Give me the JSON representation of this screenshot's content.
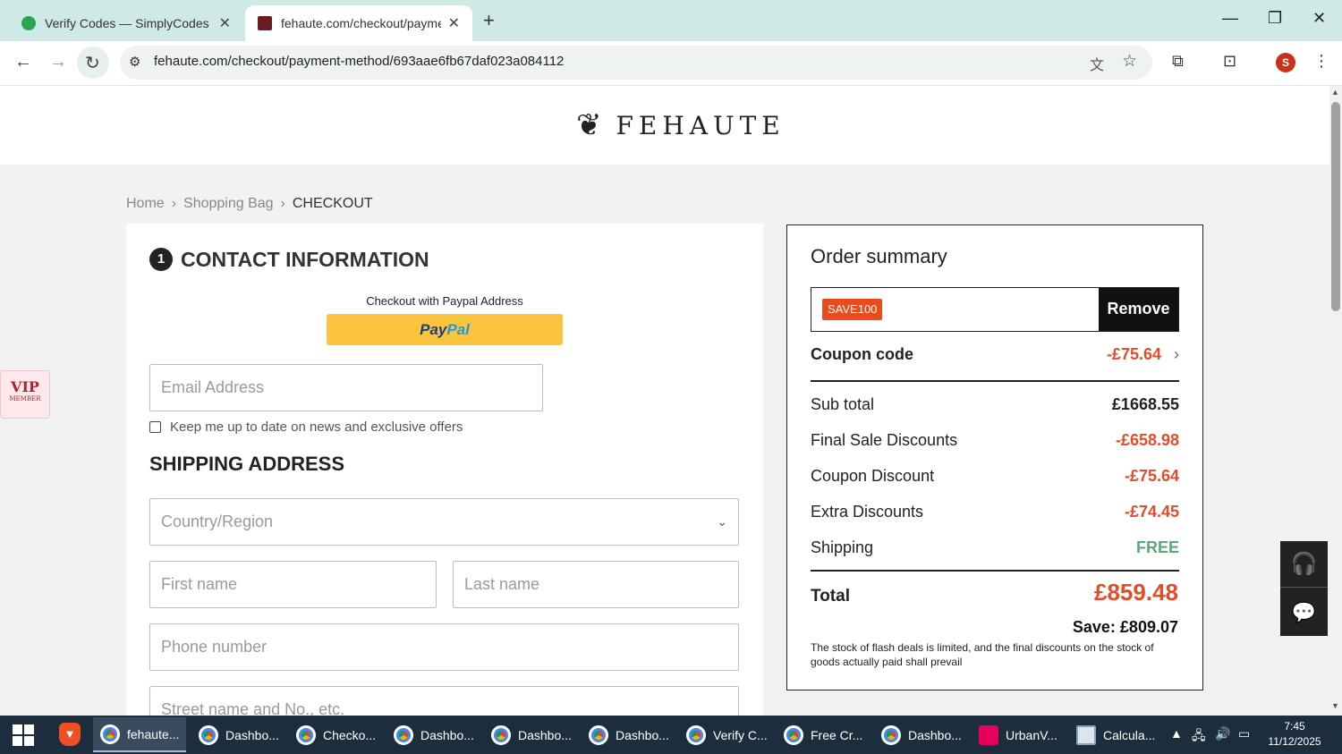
{
  "browser": {
    "tabs": [
      {
        "title": "Verify Codes — SimplyCodes",
        "active": false
      },
      {
        "title": "fehaute.com/checkout/paymen",
        "active": true
      }
    ],
    "url": "fehaute.com/checkout/payment-method/693aae6fb67daf023a084112",
    "profile_initial": "S"
  },
  "site": {
    "logo_text": "FEHAUTE",
    "breadcrumb": [
      "Home",
      "Shopping Bag",
      "CHECKOUT"
    ]
  },
  "contact": {
    "step_number": "1",
    "title": "CONTACT INFORMATION",
    "paypal_caption": "Checkout with Paypal Address",
    "paypal_pay": "Pay",
    "paypal_pal": "Pal",
    "email_placeholder": "Email Address",
    "newsletter_label": "Keep me up to date on news and exclusive offers"
  },
  "shipping": {
    "title": "SHIPPING ADDRESS",
    "country_placeholder": "Country/Region",
    "first_name_placeholder": "First name",
    "last_name_placeholder": "Last name",
    "phone_placeholder": "Phone number",
    "street_placeholder": "Street name and No., etc."
  },
  "summary": {
    "title": "Order summary",
    "coupon_tag": "SAVE100",
    "remove_label": "Remove",
    "coupon_code_label": "Coupon code",
    "coupon_code_value": "-£75.64",
    "rows": [
      {
        "label": "Sub total",
        "value": "£1668.55"
      },
      {
        "label": "Final Sale Discounts",
        "value": "-£658.98"
      },
      {
        "label": "Coupon Discount",
        "value": "-£75.64"
      },
      {
        "label": "Extra Discounts",
        "value": "-£74.45"
      },
      {
        "label": "Shipping",
        "value": "FREE"
      }
    ],
    "total_label": "Total",
    "total_value": "£859.48",
    "save_text": "Save: £809.07",
    "note": "The stock of flash deals is limited, and the final discounts on the stock of goods actually paid shall prevail"
  },
  "vip_badge": {
    "big": "VIP",
    "small": "MEMBER"
  },
  "taskbar": {
    "tasks": [
      "fehaute...",
      "Dashbo...",
      "Checko...",
      "Dashbo...",
      "Dashbo...",
      "Dashbo...",
      "Verify C...",
      "Free Cr...",
      "Dashbo...",
      "UrbanV...",
      "Calcula..."
    ],
    "time": "7:45",
    "date": "11/12/2025"
  },
  "colors": {
    "accent_red": "#e04e2a",
    "free_green": "#5ba87b",
    "paypal_yellow": "#fcc43c"
  }
}
